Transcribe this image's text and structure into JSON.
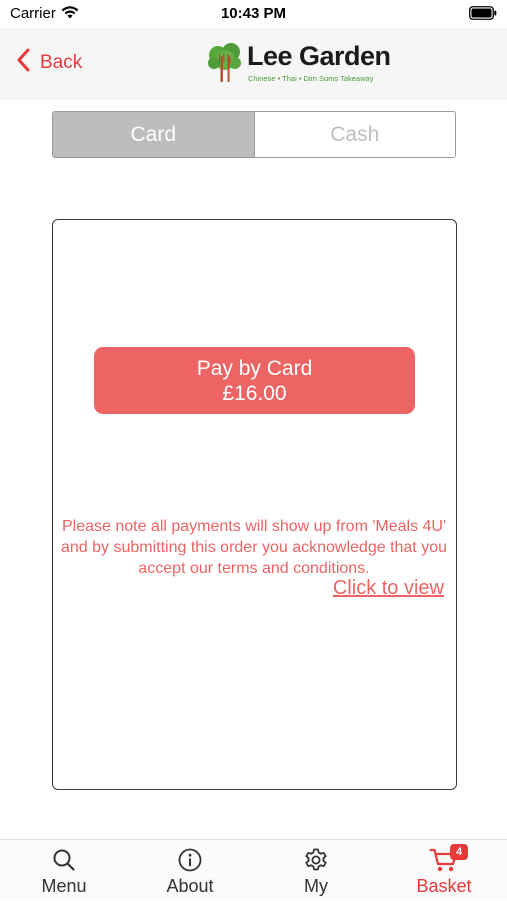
{
  "status_bar": {
    "carrier": "Carrier",
    "time": "10:43 PM"
  },
  "nav": {
    "back_label": "Back",
    "logo_name": "Lee Garden",
    "logo_tagline": "Chinese • Thai • Dim Sums Takeaway"
  },
  "payment_tabs": {
    "card_label": "Card",
    "cash_label": "Cash",
    "selected": "Card"
  },
  "card_panel": {
    "pay_button_line1": "Pay by Card",
    "pay_button_amount": "£16.00",
    "notice": "Please note all payments will show up from 'Meals 4U' and by submitting this order you acknowledge that you accept our terms and conditions.",
    "link_label": "Click to view"
  },
  "tab_bar": {
    "items": [
      {
        "label": "Menu",
        "icon": "search-icon"
      },
      {
        "label": "About",
        "icon": "info-icon"
      },
      {
        "label": "My",
        "icon": "gear-icon"
      },
      {
        "label": "Basket",
        "icon": "cart-icon",
        "badge": "4"
      }
    ],
    "active": "Basket"
  },
  "colors": {
    "accent": "#e83a3a",
    "pay_button": "#ec6464",
    "segment_active": "#bdbdbd",
    "logo_green": "#4f9b3a"
  }
}
